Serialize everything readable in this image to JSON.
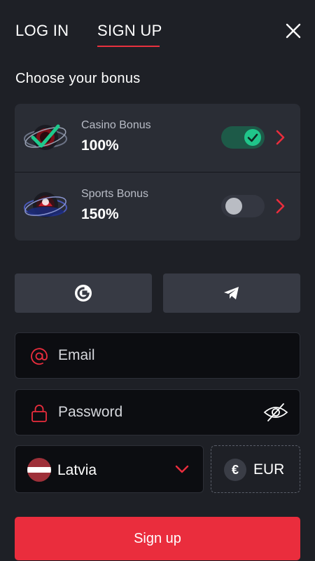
{
  "header": {
    "tabs": [
      {
        "label": "LOG IN",
        "active": false
      },
      {
        "label": "SIGN UP",
        "active": true
      }
    ],
    "close_icon": "close-icon"
  },
  "bonus": {
    "title": "Choose your bonus",
    "items": [
      {
        "name": "Casino Bonus",
        "percent": "100%",
        "enabled": true,
        "icon": "casino-bonus-icon"
      },
      {
        "name": "Sports Bonus",
        "percent": "150%",
        "enabled": false,
        "icon": "sports-bonus-icon"
      }
    ]
  },
  "social": {
    "buttons": [
      {
        "icon": "google-icon"
      },
      {
        "icon": "telegram-icon"
      }
    ]
  },
  "form": {
    "email": {
      "placeholder": "Email",
      "value": ""
    },
    "password": {
      "placeholder": "Password",
      "value": ""
    },
    "country": {
      "value": "Latvia"
    },
    "currency": {
      "value": "EUR",
      "symbol": "€"
    },
    "submit_label": "Sign up"
  },
  "colors": {
    "background": "#1e2026",
    "accent": "#ea2d3d",
    "toggle_on": "#20c58a"
  }
}
